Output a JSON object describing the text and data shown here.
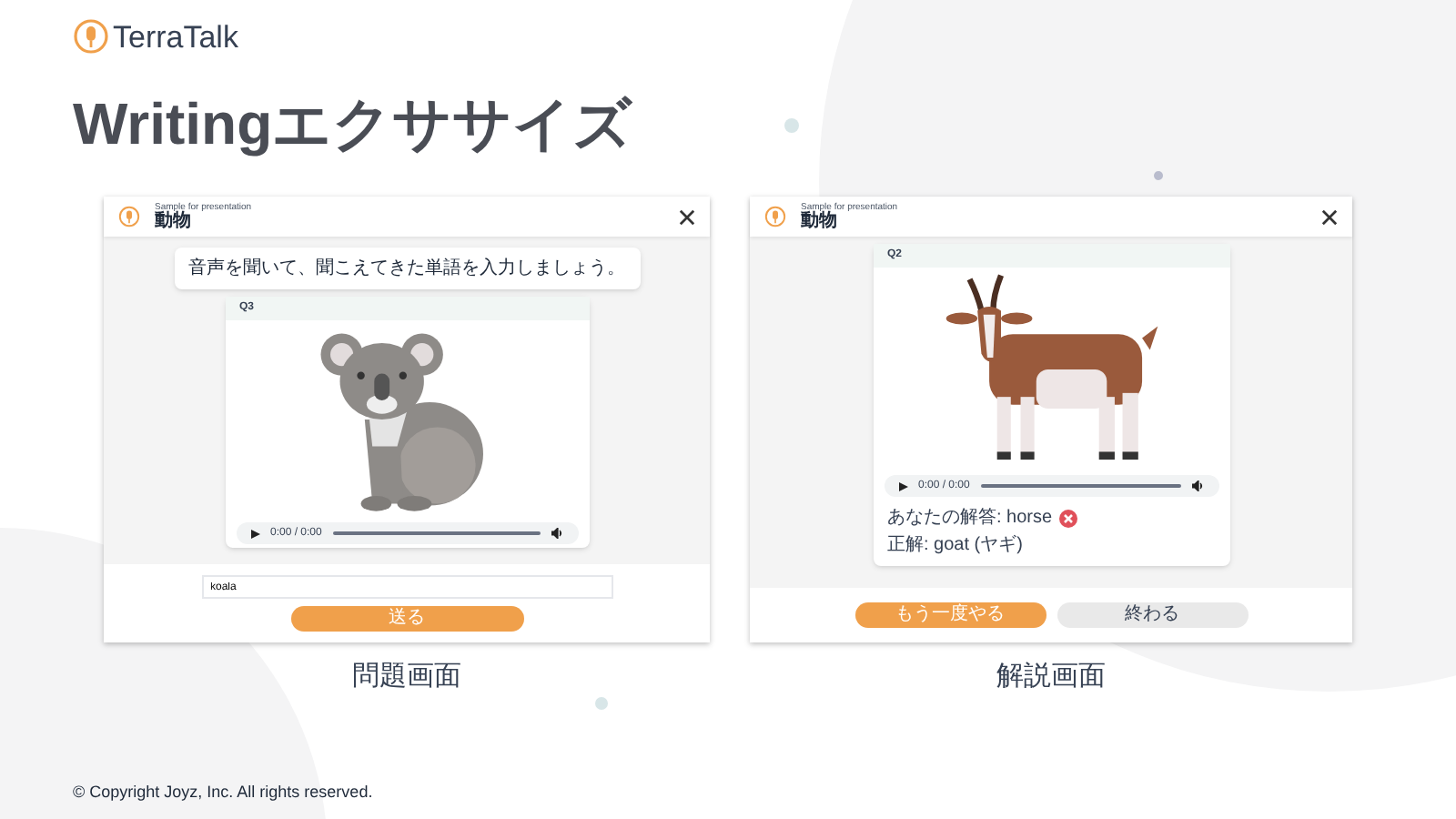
{
  "logo": {
    "text": "TerraTalk"
  },
  "title": "Writingエクササイズ",
  "question_screen": {
    "header": {
      "subtitle": "Sample for presentation",
      "title": "動物"
    },
    "instruction": "音声を聞いて、聞こえてきた単語を入力しましょう。",
    "card": {
      "label": "Q3",
      "audio_time": "0:00 / 0:00"
    },
    "answer_field": {
      "value": "koala"
    },
    "submit_button": "送る",
    "caption": "問題画面"
  },
  "explanation_screen": {
    "header": {
      "subtitle": "Sample for presentation",
      "title": "動物"
    },
    "card": {
      "label": "Q2",
      "audio_time": "0:00 / 0:00",
      "your_answer": {
        "text": "あなたの解答: horse",
        "correct": false
      },
      "correct_answer": "正解: goat (ヤギ)"
    },
    "buttons": [
      {
        "label": "もう一度やる",
        "kind": "primary"
      },
      {
        "label": "終わる",
        "kind": "secondary"
      }
    ],
    "caption": "解説画面"
  },
  "copyright": "© Copyright Joyz, Inc. All rights reserved."
}
